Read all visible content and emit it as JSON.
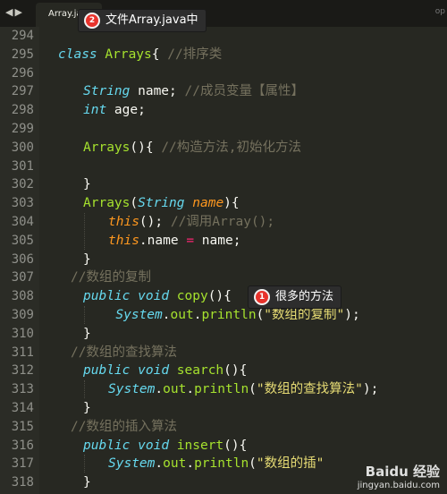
{
  "tab": {
    "title": "Array.java",
    "nav_icon": "left-right-arrows-icon",
    "right_edge": "op"
  },
  "lines": [
    {
      "num": "294",
      "indent": 0,
      "tokens": []
    },
    {
      "num": "295",
      "indent": 0,
      "tokens": [
        {
          "t": "class",
          "c": "kw"
        },
        {
          "t": " "
        },
        {
          "t": "Arrays",
          "c": "cls"
        },
        {
          "t": "{ "
        },
        {
          "t": "//排序类",
          "c": "cm"
        }
      ]
    },
    {
      "num": "296",
      "indent": 0,
      "tokens": []
    },
    {
      "num": "297",
      "indent": 1,
      "tokens": [
        {
          "t": "String",
          "c": "kw"
        },
        {
          "t": " name; "
        },
        {
          "t": "//成员变量【属性】",
          "c": "cm"
        }
      ]
    },
    {
      "num": "298",
      "indent": 1,
      "tokens": [
        {
          "t": "int",
          "c": "kw"
        },
        {
          "t": " age;"
        }
      ]
    },
    {
      "num": "299",
      "indent": 0,
      "tokens": []
    },
    {
      "num": "300",
      "indent": 1,
      "tokens": [
        {
          "t": "Arrays",
          "c": "cls"
        },
        {
          "t": "(){ "
        },
        {
          "t": "//构造方法,初始化方法",
          "c": "cm"
        }
      ]
    },
    {
      "num": "301",
      "indent": 0,
      "tokens": []
    },
    {
      "num": "302",
      "indent": 1,
      "tokens": [
        {
          "t": "}"
        }
      ]
    },
    {
      "num": "303",
      "indent": 1,
      "tokens": [
        {
          "t": "Arrays",
          "c": "cls"
        },
        {
          "t": "("
        },
        {
          "t": "String",
          "c": "kw"
        },
        {
          "t": " "
        },
        {
          "t": "name",
          "c": "pi"
        },
        {
          "t": "){"
        }
      ]
    },
    {
      "num": "304",
      "indent": 2,
      "tokens": [
        {
          "t": "this",
          "c": "self"
        },
        {
          "t": "(); "
        },
        {
          "t": "//调用Array();",
          "c": "cm"
        }
      ]
    },
    {
      "num": "305",
      "indent": 2,
      "tokens": [
        {
          "t": "this",
          "c": "self"
        },
        {
          "t": ".name "
        },
        {
          "t": "=",
          "c": "op"
        },
        {
          "t": " name;"
        }
      ]
    },
    {
      "num": "306",
      "indent": 1,
      "tokens": [
        {
          "t": "}"
        }
      ]
    },
    {
      "num": "307",
      "indent": 0.5,
      "tokens": [
        {
          "t": "//数组的复制",
          "c": "cm"
        }
      ]
    },
    {
      "num": "308",
      "indent": 1,
      "tokens": [
        {
          "t": "public",
          "c": "kw"
        },
        {
          "t": " "
        },
        {
          "t": "void",
          "c": "kw"
        },
        {
          "t": " "
        },
        {
          "t": "copy",
          "c": "cls"
        },
        {
          "t": "(){"
        }
      ]
    },
    {
      "num": "309",
      "indent": 2.3,
      "tokens": [
        {
          "t": "System",
          "c": "kw"
        },
        {
          "t": "."
        },
        {
          "t": "out",
          "c": "cls"
        },
        {
          "t": "."
        },
        {
          "t": "println",
          "c": "cls"
        },
        {
          "t": "("
        },
        {
          "t": "\"数组的复制\"",
          "c": "str"
        },
        {
          "t": ");"
        }
      ]
    },
    {
      "num": "310",
      "indent": 1,
      "tokens": [
        {
          "t": "}"
        }
      ]
    },
    {
      "num": "311",
      "indent": 0.5,
      "tokens": [
        {
          "t": "//数组的查找算法",
          "c": "cm"
        }
      ]
    },
    {
      "num": "312",
      "indent": 1,
      "tokens": [
        {
          "t": "public",
          "c": "kw"
        },
        {
          "t": " "
        },
        {
          "t": "void",
          "c": "kw"
        },
        {
          "t": " "
        },
        {
          "t": "search",
          "c": "cls"
        },
        {
          "t": "(){"
        }
      ]
    },
    {
      "num": "313",
      "indent": 2,
      "tokens": [
        {
          "t": "System",
          "c": "kw"
        },
        {
          "t": "."
        },
        {
          "t": "out",
          "c": "cls"
        },
        {
          "t": "."
        },
        {
          "t": "println",
          "c": "cls"
        },
        {
          "t": "("
        },
        {
          "t": "\"数组的查找算法\"",
          "c": "str"
        },
        {
          "t": ");"
        }
      ]
    },
    {
      "num": "314",
      "indent": 1,
      "tokens": [
        {
          "t": "}"
        }
      ]
    },
    {
      "num": "315",
      "indent": 0.5,
      "tokens": [
        {
          "t": "//数组的插入算法",
          "c": "cm"
        }
      ]
    },
    {
      "num": "316",
      "indent": 1,
      "tokens": [
        {
          "t": "public",
          "c": "kw"
        },
        {
          "t": " "
        },
        {
          "t": "void",
          "c": "kw"
        },
        {
          "t": " "
        },
        {
          "t": "insert",
          "c": "cls"
        },
        {
          "t": "(){"
        }
      ]
    },
    {
      "num": "317",
      "indent": 2,
      "tokens": [
        {
          "t": "System",
          "c": "kw"
        },
        {
          "t": "."
        },
        {
          "t": "out",
          "c": "cls"
        },
        {
          "t": "."
        },
        {
          "t": "println",
          "c": "cls"
        },
        {
          "t": "("
        },
        {
          "t": "\"数组的插\"",
          "c": "str"
        }
      ]
    },
    {
      "num": "318",
      "indent": 1,
      "tokens": [
        {
          "t": "}"
        }
      ]
    }
  ],
  "annotations": [
    {
      "badge": "2",
      "text": "文件Array.java中"
    },
    {
      "badge": "1",
      "text": "很多的方法"
    }
  ],
  "watermark": {
    "brand": "Baidu 经验",
    "url": "jingyan.baidu.com"
  }
}
